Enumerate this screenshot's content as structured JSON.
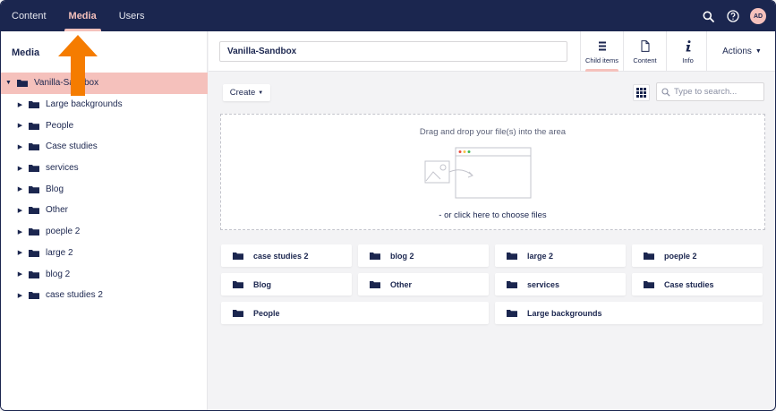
{
  "topnav": {
    "items": [
      "Content",
      "Media",
      "Users"
    ],
    "active": "Media"
  },
  "user": {
    "initials": "AD"
  },
  "sidebar": {
    "title": "Media",
    "root": "Vanilla-Sandbox",
    "children": [
      "Large backgrounds",
      "People",
      "Case studies",
      "services",
      "Blog",
      "Other",
      "poeple 2",
      "large 2",
      "blog 2",
      "case studies 2"
    ]
  },
  "main": {
    "name": "Vanilla-Sandbox",
    "apps": [
      "Child items",
      "Content",
      "Info"
    ],
    "actions": "Actions",
    "create": "Create",
    "search_placeholder": "Type to search...",
    "dropzone": {
      "text": "Drag and drop your file(s) into the area",
      "link": "- or click here to choose files"
    },
    "folders": [
      "case studies 2",
      "blog 2",
      "large 2",
      "poeple 2",
      "Blog",
      "Other",
      "services",
      "Case studies",
      "People",
      "Large backgrounds"
    ]
  },
  "colors": {
    "header": "#1b264f",
    "accent": "#f5c1bc",
    "arrow": "#f57c00"
  }
}
